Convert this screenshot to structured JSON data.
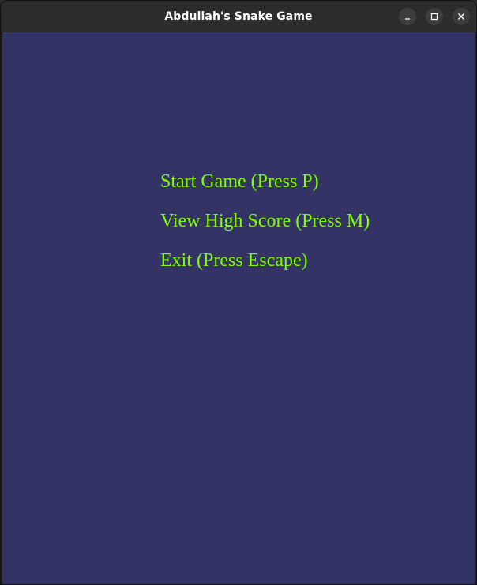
{
  "window": {
    "title": "Abdullah's Snake Game"
  },
  "controls": {
    "minimize_icon": "minimize-icon",
    "maximize_icon": "maximize-icon",
    "close_icon": "close-icon"
  },
  "menu": {
    "items": [
      {
        "label": "Start Game (Press P)"
      },
      {
        "label": "View High Score (Press M)"
      },
      {
        "label": "Exit (Press Escape)"
      }
    ]
  },
  "colors": {
    "background": "#333366",
    "menu_text": "#7fff00",
    "titlebar": "#2c2c2c"
  }
}
